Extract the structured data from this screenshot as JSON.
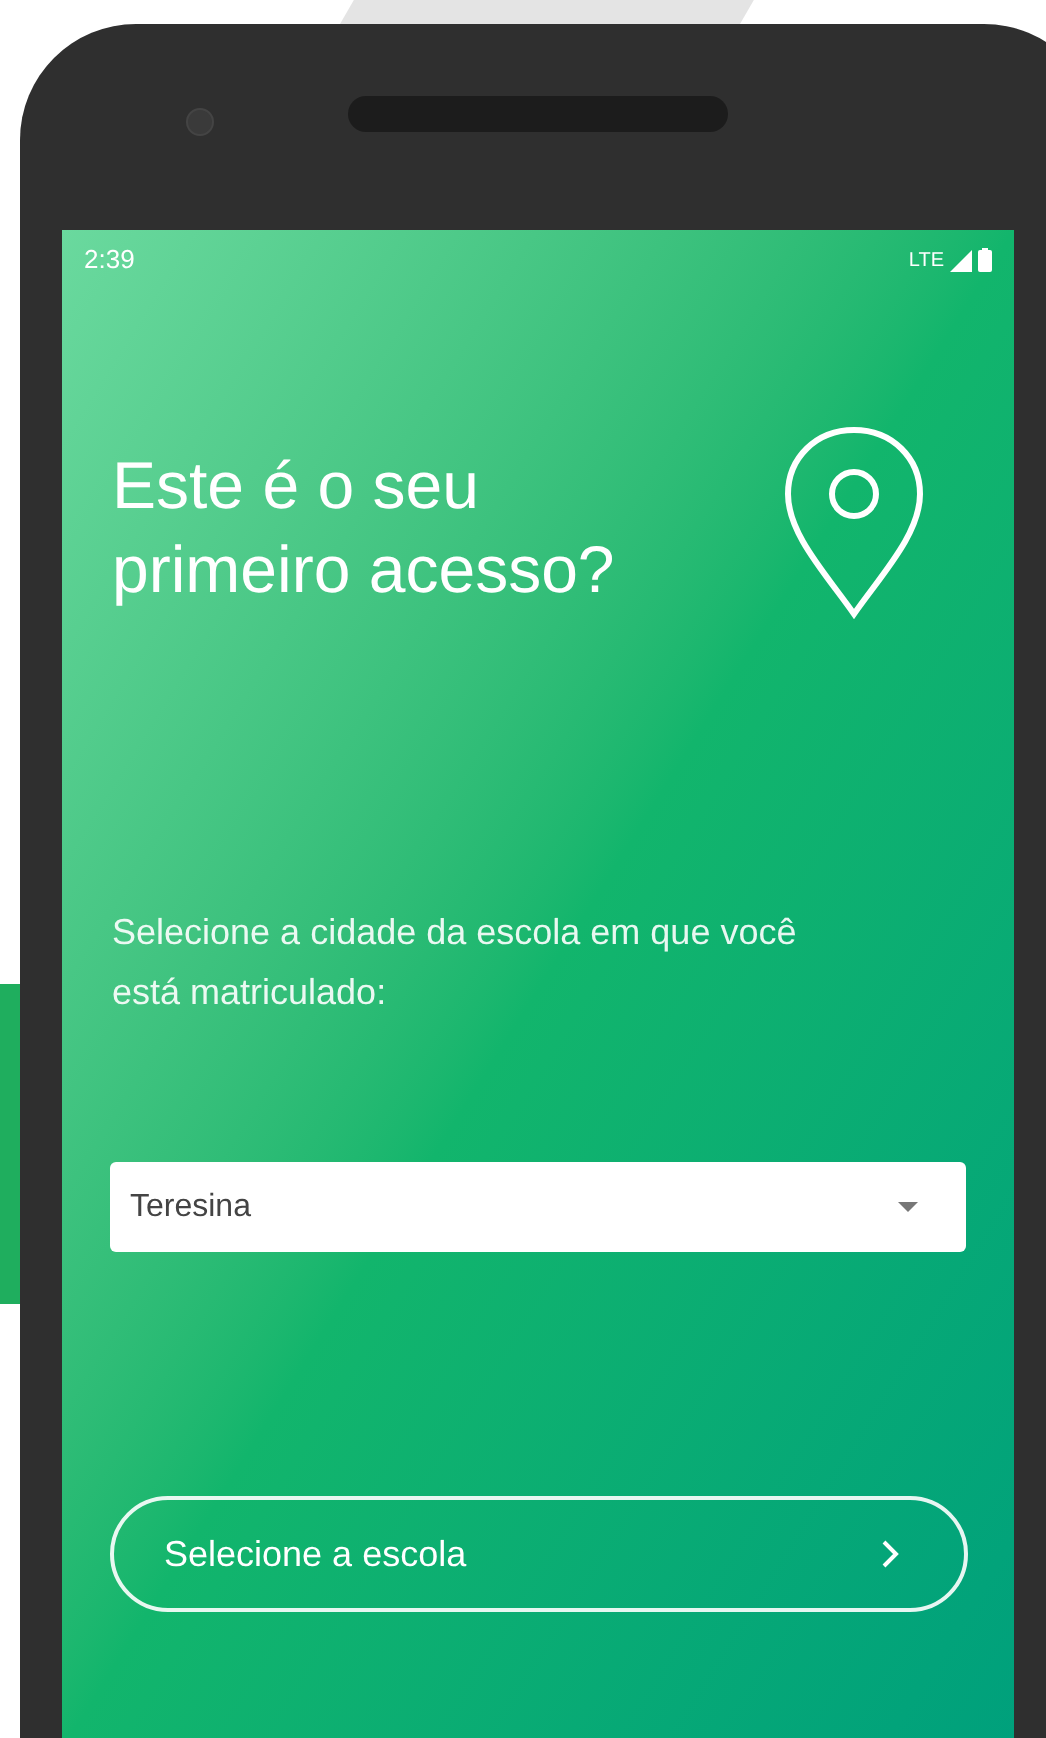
{
  "status_bar": {
    "time": "2:39",
    "network": "LTE"
  },
  "title": "Este é o seu primeiro acesso?",
  "instruction": "Selecione a cidade da escola em que você está matriculado:",
  "city_select": {
    "value": "Teresina"
  },
  "school_button": {
    "label": "Selecione a escola"
  }
}
